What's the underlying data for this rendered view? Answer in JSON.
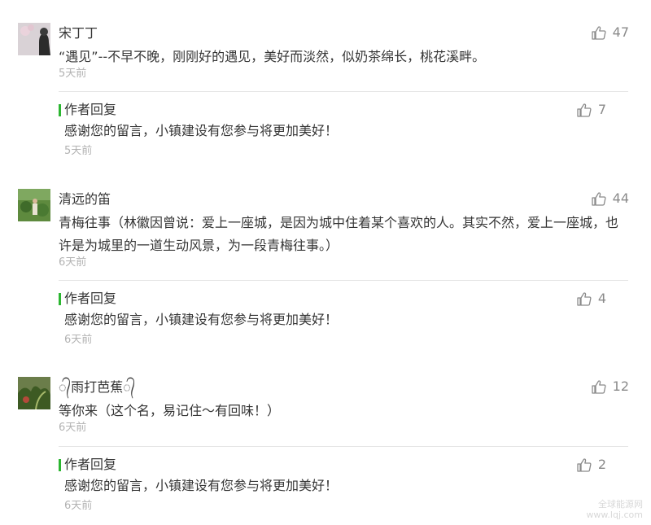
{
  "comments": [
    {
      "nickname": "宋丁丁",
      "content": "“遇见”--不早不晚，刚刚好的遇见，美好而淡然，似奶茶绵长，桃花溪畔。",
      "time": "5天前",
      "likes": "47",
      "reply": {
        "label": "作者回复",
        "content": "感谢您的留言，小镇建设有您参与将更加美好！",
        "time": "5天前",
        "likes": "7"
      }
    },
    {
      "nickname": "清远的笛",
      "content": "青梅往事（林徽因曾说：爱上一座城，是因为城中住着某个喜欢的人。其实不然，爱上一座城，也许是为城里的一道生动风景，为一段青梅往事。）",
      "time": "6天前",
      "likes": "44",
      "reply": {
        "label": "作者回复",
        "content": "感谢您的留言，小镇建设有您参与将更加美好！",
        "time": "6天前",
        "likes": "4"
      }
    },
    {
      "nickname": "᭄雨打芭蕉᭄",
      "content": "等你来（这个名，易记住～有回味！）",
      "time": "6天前",
      "likes": "12",
      "reply": {
        "label": "作者回复",
        "content": "感谢您的留言，小镇建设有您参与将更加美好！",
        "time": "6天前",
        "likes": "2"
      }
    }
  ],
  "watermark": {
    "line1": "全球能源网",
    "line2": "www.lqj.com"
  },
  "colors": {
    "accent_green": "#2cb631",
    "muted": "#b2b2b2",
    "like_icon": "#8a8a8a"
  },
  "icons": {
    "like": "thumbs-up-icon"
  }
}
